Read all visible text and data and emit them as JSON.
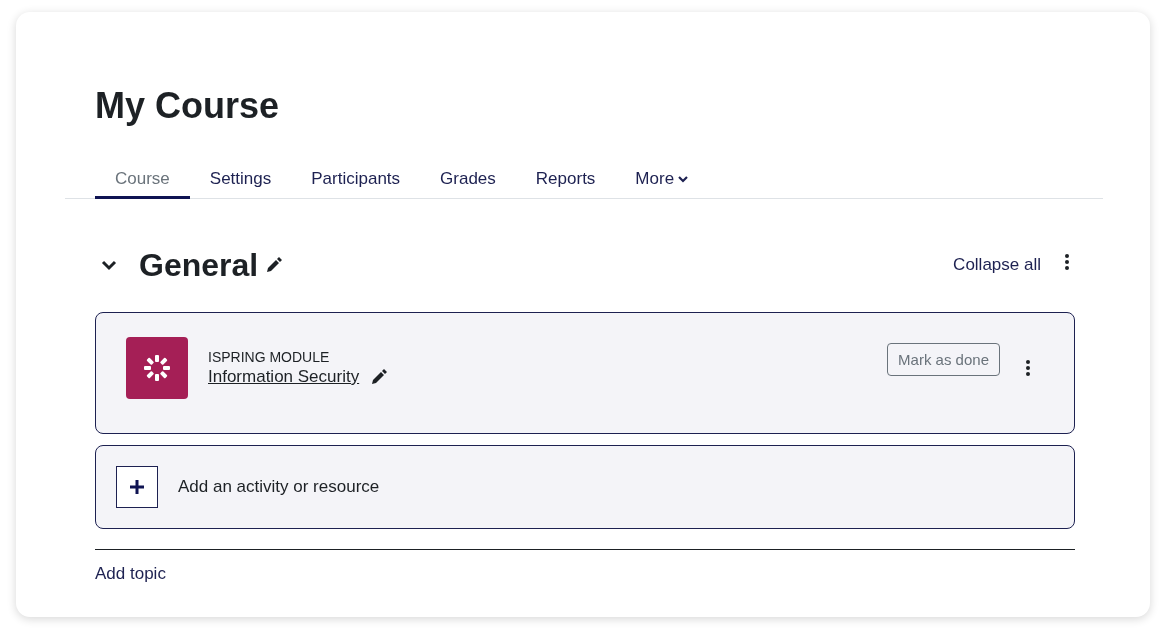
{
  "course": {
    "title": "My Course"
  },
  "tabs": [
    {
      "label": "Course",
      "selected": true
    },
    {
      "label": "Settings",
      "selected": false
    },
    {
      "label": "Participants",
      "selected": false
    },
    {
      "label": "Grades",
      "selected": false
    },
    {
      "label": "Reports",
      "selected": false
    },
    {
      "label": "More",
      "selected": false,
      "kind": "menu"
    }
  ],
  "section": {
    "title": "General",
    "expanded": true,
    "collapse_link": "Collapse all",
    "activities": [
      {
        "type": "ISPRING MODULE",
        "name": "Information Security",
        "completion_button": "Mark as done",
        "color": "#a51f56"
      }
    ],
    "add_activity": "Add an activity or resource"
  },
  "add_topic": "Add topic"
}
